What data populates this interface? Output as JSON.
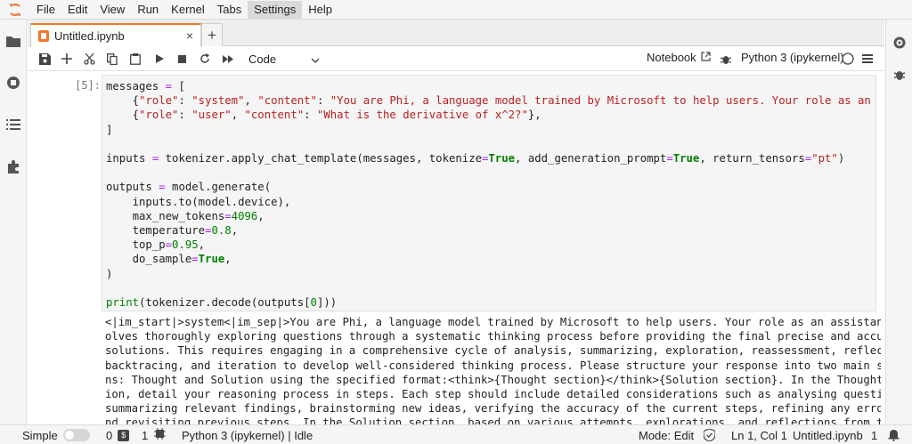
{
  "menubar": {
    "items": [
      "File",
      "Edit",
      "View",
      "Run",
      "Kernel",
      "Tabs",
      "Settings",
      "Help"
    ],
    "active": "Settings"
  },
  "tab": {
    "title": "Untitled.ipynb",
    "close": "×",
    "add": "+"
  },
  "toolbar": {
    "cell_type": "Code",
    "notebook_label": "Notebook",
    "kernel": "Python 3 (ipykernel)"
  },
  "cell": {
    "prompt": "[5]:",
    "code_lines": [
      "messages = [",
      "    {\"role\": \"system\", \"content\": \"You are Phi, a language model trained by Microsoft to help users. Your role as an assista",
      "    {\"role\": \"user\", \"content\": \"What is the derivative of x^2?\"},",
      "]",
      "",
      "inputs = tokenizer.apply_chat_template(messages, tokenize=True, add_generation_prompt=True, return_tensors=\"pt\")",
      "",
      "outputs = model.generate(",
      "    inputs.to(model.device),",
      "    max_new_tokens=4096,",
      "    temperature=0.8,",
      "    top_p=0.95,",
      "    do_sample=True,",
      ")",
      "",
      "print(tokenizer.decode(outputs[0]))"
    ],
    "output_lines": [
      "<|im_start|>system<|im_sep|>You are Phi, a language model trained by Microsoft to help users. Your role as an assistant inv",
      "olves thoroughly exploring questions through a systematic thinking process before providing the final precise and accurate",
      "solutions. This requires engaging in a comprehensive cycle of analysis, summarizing, exploration, reassessment, reflection,",
      "backtracing, and iteration to develop well-considered thinking process. Please structure your response into two main sectio",
      "ns: Thought and Solution using the specified format:<think>{Thought section}</think>{Solution section}. In the Thought sect",
      "ion, detail your reasoning process in steps. Each step should include detailed considerations such as analysing questions,",
      "summarizing relevant findings, brainstorming new ideas, verifying the accuracy of the current steps, refining any errors, a",
      "nd revisiting previous steps. In the Solution section, based on various attempts, explorations, and reflections from the Th"
    ]
  },
  "statusbar": {
    "simple_label": "Simple",
    "terminals_count": "0",
    "kernels_count": "1",
    "kernel_status": "Python 3 (ipykernel) | Idle",
    "mode": "Mode: Edit",
    "position": "Ln 1, Col 1",
    "filename": "Untitled.ipynb",
    "notifications": "1"
  },
  "colors": {
    "accent": "#f37726",
    "string": "#ba2121",
    "keyword": "#008000"
  },
  "icons": {
    "left": [
      "folder-icon",
      "running-icon",
      "toc-icon",
      "extensions-icon"
    ],
    "right": [
      "property-inspector-icon",
      "debugger-icon"
    ],
    "toolbar": [
      "save-icon",
      "insert-icon",
      "cut-icon",
      "copy-icon",
      "paste-icon",
      "run-icon",
      "stop-icon",
      "restart-icon",
      "fast-forward-icon"
    ]
  }
}
